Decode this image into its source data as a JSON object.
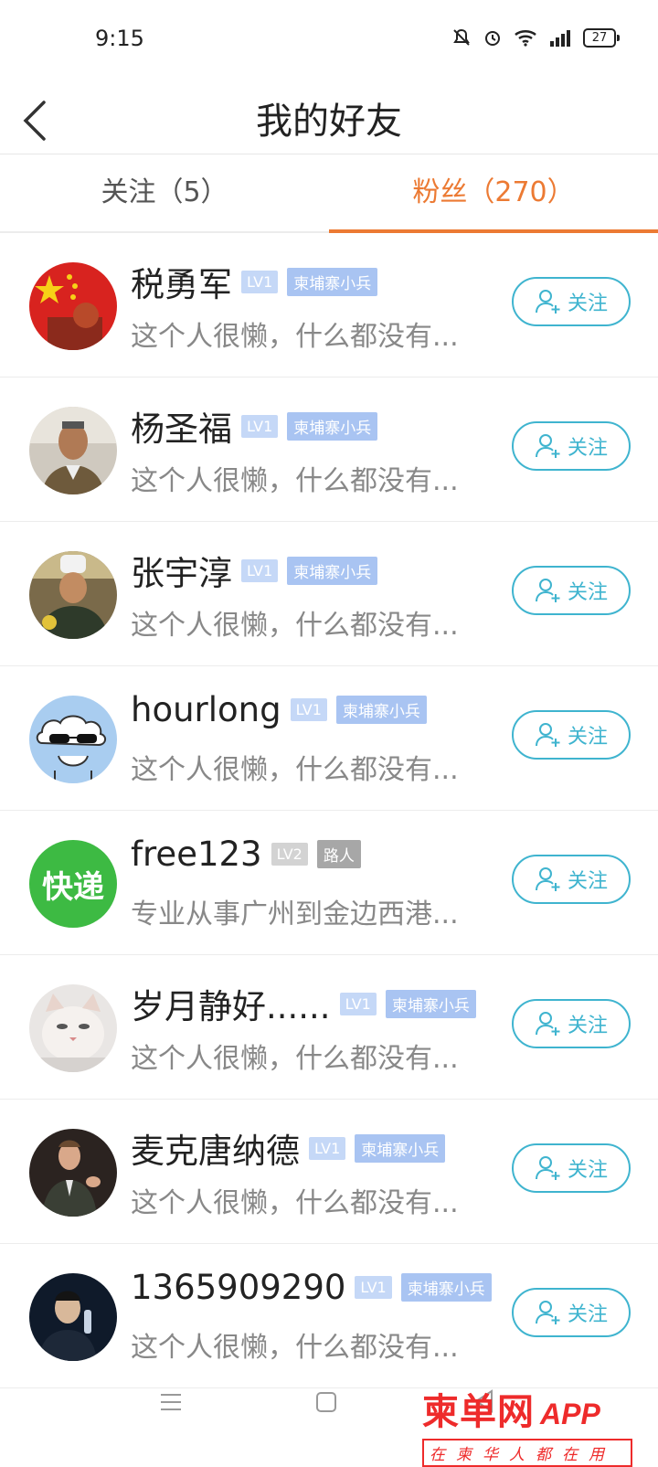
{
  "status_bar": {
    "time": "9:15",
    "battery": "27",
    "icons": [
      "mute-bell-icon",
      "alarm-icon",
      "wifi-icon",
      "signal-icon",
      "battery-icon"
    ]
  },
  "header": {
    "title": "我的好友"
  },
  "tabs": [
    {
      "label": "关注（5）",
      "active": false
    },
    {
      "label": "粉丝（270）",
      "active": true
    }
  ],
  "follow_label": "关注",
  "users": [
    {
      "name": "税勇军",
      "level": "LV1",
      "rank": "柬埔寨小兵",
      "bio": "这个人很懒，什么都没有..."
    },
    {
      "name": "杨圣福",
      "level": "LV1",
      "rank": "柬埔寨小兵",
      "bio": "这个人很懒，什么都没有..."
    },
    {
      "name": "张宇淳",
      "level": "LV1",
      "rank": "柬埔寨小兵",
      "bio": "这个人很懒，什么都没有..."
    },
    {
      "name": "hourlong",
      "level": "LV1",
      "rank": "柬埔寨小兵",
      "bio": "这个人很懒，什么都没有..."
    },
    {
      "name": "free123",
      "level": "LV2",
      "rank": "路人",
      "bio": "专业从事广州到金边西港...",
      "avatar_text": "快递"
    },
    {
      "name": "岁月静好......",
      "level": "LV1",
      "rank": "柬埔寨小兵",
      "bio": "这个人很懒，什么都没有..."
    },
    {
      "name": "麦克唐纳德",
      "level": "LV1",
      "rank": "柬埔寨小兵",
      "bio": "这个人很懒，什么都没有..."
    },
    {
      "name": "1365909290",
      "level": "LV1",
      "rank": "柬埔寨小兵",
      "bio": "这个人很懒，什么都没有..."
    }
  ],
  "watermark": {
    "main": "柬单网",
    "app": "APP",
    "sub": "在柬华人都在用"
  },
  "colors": {
    "accent": "#ec7a33",
    "follow": "#3fb4cf",
    "watermark": "#ee2b2b"
  }
}
